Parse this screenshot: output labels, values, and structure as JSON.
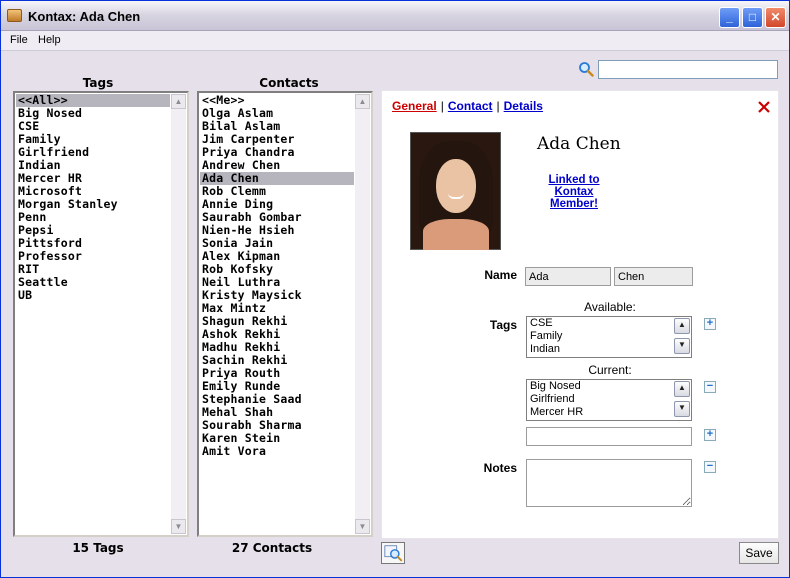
{
  "window": {
    "title": "Kontax: Ada Chen"
  },
  "menu": {
    "file": "File",
    "help": "Help"
  },
  "tags_panel": {
    "label": "Tags",
    "items": [
      "<<All>>",
      "Big Nosed",
      "CSE",
      "Family",
      "Girlfriend",
      "Indian",
      "Mercer HR",
      "Microsoft",
      "Morgan Stanley",
      "Penn",
      "Pepsi",
      "Pittsford",
      "Professor",
      "RIT",
      "Seattle",
      "UB"
    ],
    "selected": "<<All>>",
    "count": "15 Tags"
  },
  "contacts_panel": {
    "label": "Contacts",
    "items": [
      "<<Me>>",
      "Olga Aslam",
      "Bilal Aslam",
      "Jim Carpenter",
      "Priya Chandra",
      "Andrew Chen",
      "Ada Chen",
      "Rob Clemm",
      "Annie Ding",
      "Saurabh Gombar",
      "Nien-He Hsieh",
      "Sonia Jain",
      "Alex Kipman",
      "Rob Kofsky",
      "Neil Luthra",
      "Kristy Maysick",
      "Max Mintz",
      "Shagun Rekhi",
      "Ashok Rekhi",
      "Madhu Rekhi",
      "Sachin Rekhi",
      "Priya Routh",
      "Emily Runde",
      "Stephanie Saad",
      "Mehal Shah",
      "Sourabh Sharma",
      "Karen Stein",
      "Amit Vora"
    ],
    "selected": "Ada Chen",
    "count": "27 Contacts"
  },
  "search": {
    "value": ""
  },
  "detail": {
    "tabs": [
      "General",
      "Contact",
      "Details"
    ],
    "active_tab": "General",
    "name": "Ada Chen",
    "linked_text": "Linked to Kontax Member!",
    "name_label": "Name",
    "first_name": "Ada",
    "last_name": "Chen",
    "tags_label": "Tags",
    "available_label": "Available:",
    "available_tags": [
      "CSE",
      "Family",
      "Indian"
    ],
    "current_label": "Current:",
    "current_tags": [
      "Big Nosed",
      "Girlfriend",
      "Mercer HR"
    ],
    "new_tag_value": "",
    "notes_label": "Notes",
    "notes_value": ""
  },
  "save_label": "Save",
  "colors": {
    "active_tab": "#cc0000",
    "link": "#0000cc",
    "close_x": "#cc0000"
  }
}
